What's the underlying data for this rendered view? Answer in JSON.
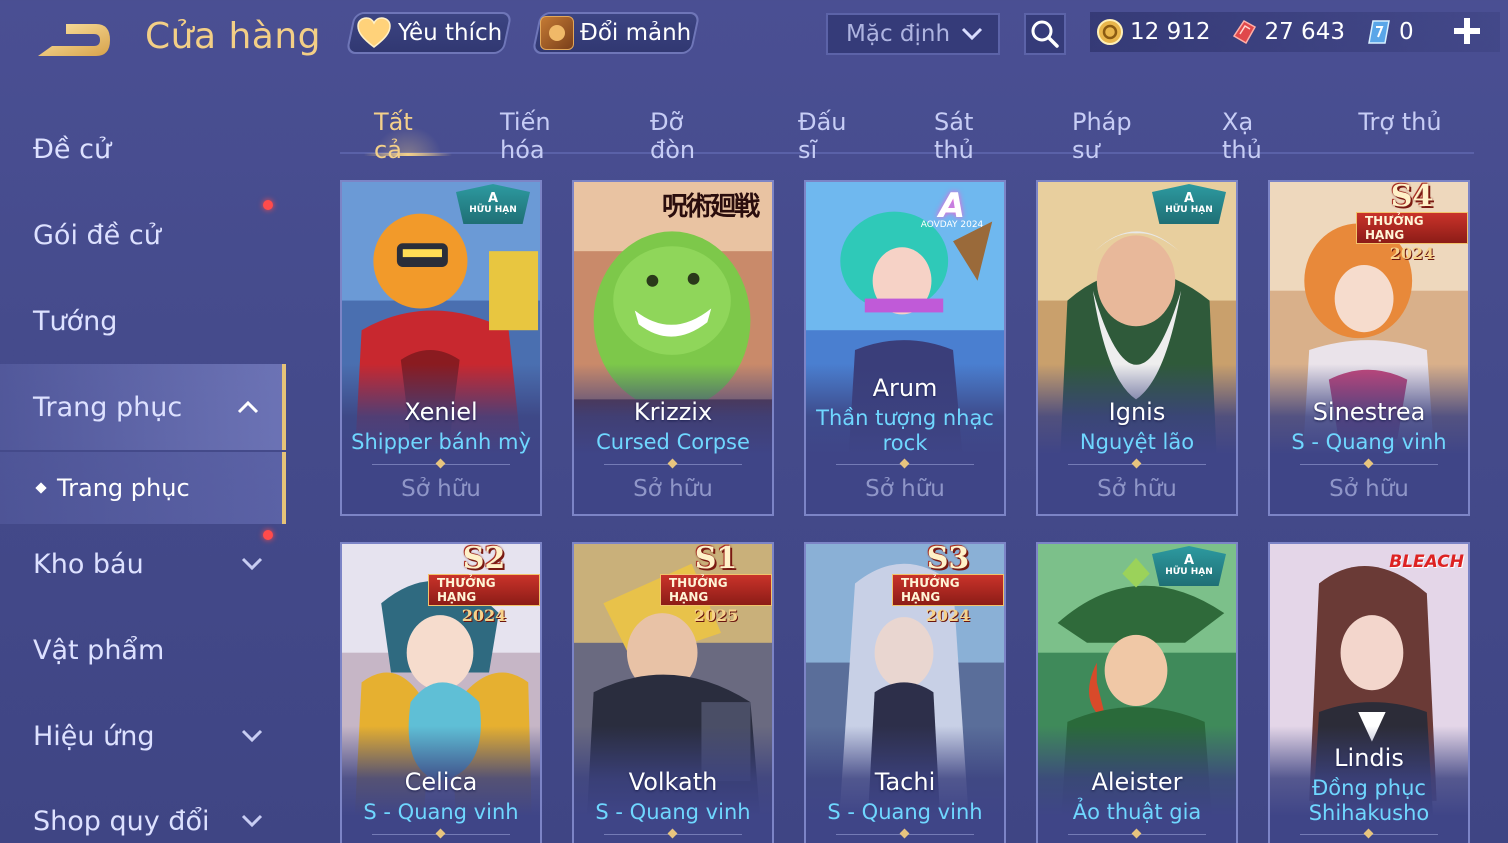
{
  "header": {
    "title": "Cửa hàng",
    "favorite_label": "Yêu thích",
    "exchange_label": "Đổi mảnh",
    "sort_value": "Mặc định",
    "currencies": [
      {
        "icon": "gold-coin-icon",
        "value": "12 912"
      },
      {
        "icon": "red-voucher-icon",
        "value": "27 643"
      },
      {
        "icon": "blue-ticket-icon",
        "value": "0"
      }
    ]
  },
  "sidebar": {
    "items": [
      {
        "label": "Đề cử"
      },
      {
        "label": "Gói đề cử"
      },
      {
        "label": "Tướng"
      },
      {
        "label": "Trang phục"
      },
      {
        "label": "Trang phục"
      },
      {
        "label": "Kho báu"
      },
      {
        "label": "Vật phẩm"
      },
      {
        "label": "Hiệu ứng"
      },
      {
        "label": "Shop quy đổi"
      }
    ]
  },
  "tabs": [
    {
      "label": "Tất cả"
    },
    {
      "label": "Tiến hóa"
    },
    {
      "label": "Đỡ đòn"
    },
    {
      "label": "Đấu sĩ"
    },
    {
      "label": "Sát thủ"
    },
    {
      "label": "Pháp sư"
    },
    {
      "label": "Xạ thủ"
    },
    {
      "label": "Trợ thủ"
    }
  ],
  "cards": [
    {
      "hero": "Xeniel",
      "skin": "Shipper bánh mỳ",
      "status": "Sở hữu",
      "badge": "A",
      "badge_text": "HỮU HẠN"
    },
    {
      "hero": "Krizzix",
      "skin": "Cursed Corpse",
      "status": "Sở hữu",
      "badge": "seal",
      "badge_text": "呪術廻戦"
    },
    {
      "hero": "Arum",
      "skin": "Thần tượng nhạc rock",
      "status": "Sở hữu",
      "badge": "aov",
      "badge_text": "AOVDAY 2024"
    },
    {
      "hero": "Ignis",
      "skin": "Nguyệt lão",
      "status": "Sở hữu",
      "badge": "A",
      "badge_text": "HỮU HẠN"
    },
    {
      "hero": "Sinestrea",
      "skin": "S - Quang vinh",
      "status": "Sở hữu",
      "badge": "S",
      "season": "S4",
      "rank_text": "THƯỞNG HẠNG",
      "year": "2024"
    },
    {
      "hero": "Celica",
      "skin": "S - Quang vinh",
      "badge": "S",
      "season": "S2",
      "rank_text": "THƯỞNG HẠNG",
      "year": "2024"
    },
    {
      "hero": "Volkath",
      "skin": "S - Quang vinh",
      "badge": "S",
      "season": "S1",
      "rank_text": "THƯỞNG HẠNG",
      "year": "2025"
    },
    {
      "hero": "Tachi",
      "skin": "S - Quang vinh",
      "badge": "S",
      "season": "S3",
      "rank_text": "THƯỞNG HẠNG",
      "year": "2024"
    },
    {
      "hero": "Aleister",
      "skin": "Ảo thuật gia",
      "badge": "A",
      "badge_text": "HỮU HẠN"
    },
    {
      "hero": "Lindis",
      "skin": "Đồng phục Shihakusho",
      "badge": "bleach",
      "badge_text": "BLEACH"
    }
  ],
  "colors": {
    "background": "#474d8e",
    "accent_gold": "#f3cf86",
    "skin_name_blue": "#6fd7ff",
    "notification_red": "#ff4b4b"
  }
}
